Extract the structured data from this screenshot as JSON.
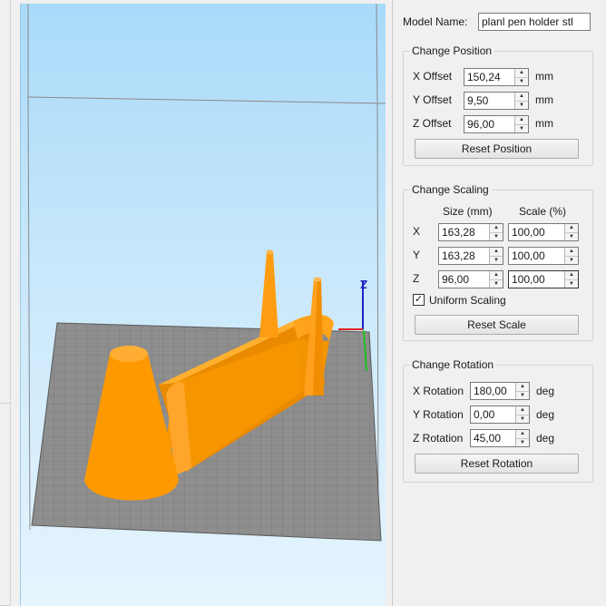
{
  "model_name": {
    "label": "Model Name:",
    "value": "planl pen holder stl"
  },
  "position": {
    "title": "Change Position",
    "x": {
      "label": "X Offset",
      "value": "150,24",
      "unit": "mm"
    },
    "y": {
      "label": "Y Offset",
      "value": "9,50",
      "unit": "mm"
    },
    "z": {
      "label": "Z Offset",
      "value": "96,00",
      "unit": "mm"
    },
    "reset": "Reset Position"
  },
  "scaling": {
    "title": "Change Scaling",
    "size_header": "Size (mm)",
    "scale_header": "Scale (%)",
    "x": {
      "label": "X",
      "size": "163,28",
      "scale": "100,00"
    },
    "y": {
      "label": "Y",
      "size": "163,28",
      "scale": "100,00"
    },
    "z": {
      "label": "Z",
      "size": "96,00",
      "scale": "100,00"
    },
    "uniform": {
      "label": "Uniform Scaling",
      "checked": true,
      "mark": "✓"
    },
    "reset": "Reset Scale"
  },
  "rotation": {
    "title": "Change Rotation",
    "x": {
      "label": "X Rotation",
      "value": "180,00",
      "unit": "deg"
    },
    "y": {
      "label": "Y Rotation",
      "value": "0,00",
      "unit": "deg"
    },
    "z": {
      "label": "Z Rotation",
      "value": "45,00",
      "unit": "deg"
    },
    "reset": "Reset Rotation"
  },
  "viewport": {
    "axis_z_label": "Z",
    "colors": {
      "model": "#ff9900",
      "bed": "#8c8c8c",
      "sky": "#b3dffa",
      "axis_x": "#e02020",
      "axis_y": "#20c020",
      "axis_z": "#2020c0"
    }
  },
  "icons": {
    "spin_up": "▲",
    "spin_down": "▼"
  }
}
